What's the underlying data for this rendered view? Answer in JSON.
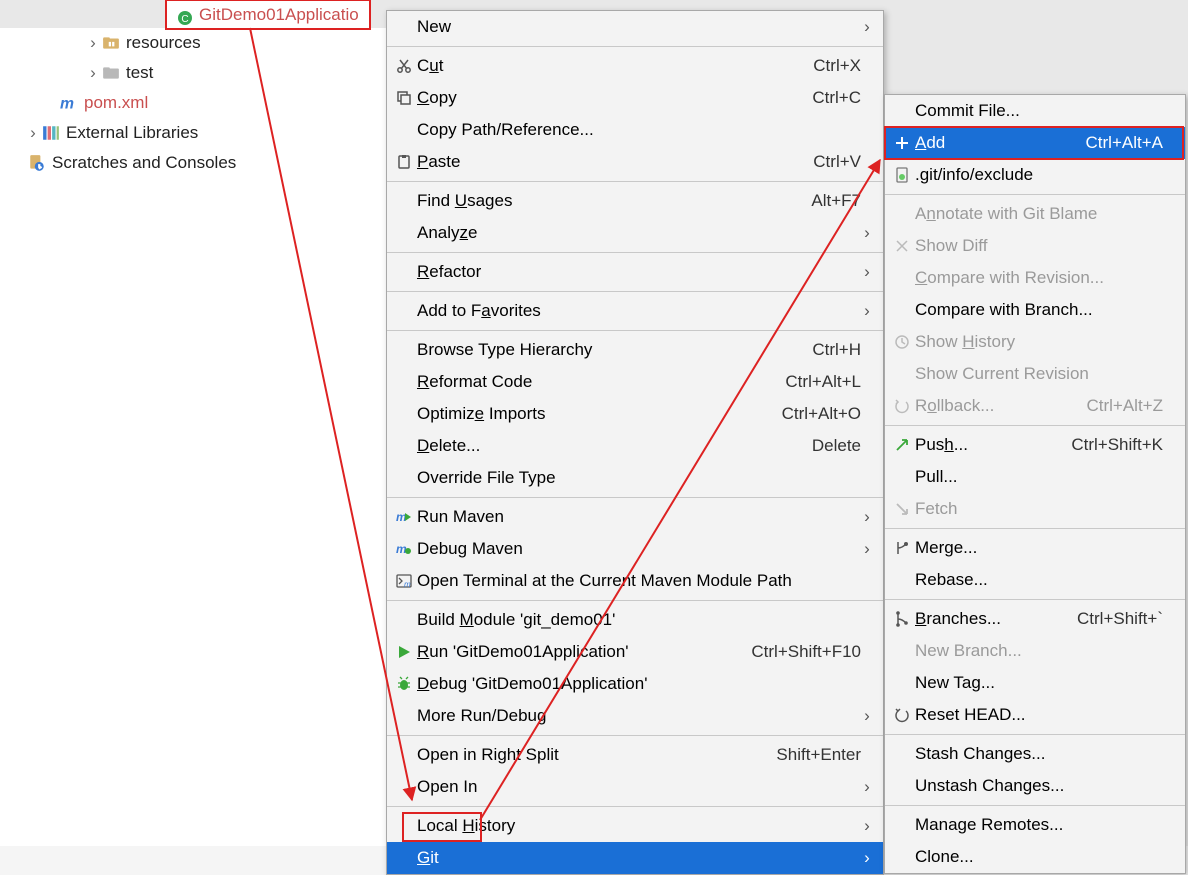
{
  "tabs": {
    "active": "GitDemo01Applicatio"
  },
  "tree": {
    "resources": "resources",
    "test": "test",
    "pom": "pom.xml",
    "ext_lib": "External Libraries",
    "scratches": "Scratches and Consoles"
  },
  "menu1": {
    "new": "New",
    "cut": "Cut",
    "cut_sc": "Ctrl+X",
    "copy": "Copy",
    "copy_sc": "Ctrl+C",
    "copy_path": "Copy Path/Reference...",
    "paste": "Paste",
    "paste_sc": "Ctrl+V",
    "find_usages": "Find Usages",
    "find_usages_sc": "Alt+F7",
    "analyze": "Analyze",
    "refactor": "Refactor",
    "favorites": "Add to Favorites",
    "type_hier": "Browse Type Hierarchy",
    "type_hier_sc": "Ctrl+H",
    "reformat": "Reformat Code",
    "reformat_sc": "Ctrl+Alt+L",
    "optimize": "Optimize Imports",
    "optimize_sc": "Ctrl+Alt+O",
    "delete": "Delete...",
    "delete_sc": "Delete",
    "override_ft": "Override File Type",
    "run_maven": "Run Maven",
    "debug_maven": "Debug Maven",
    "open_term_maven": "Open Terminal at the Current Maven Module Path",
    "build_module": "Build Module 'git_demo01'",
    "run_app": "Run 'GitDemo01Application'",
    "run_app_sc": "Ctrl+Shift+F10",
    "debug_app": "Debug 'GitDemo01Application'",
    "more_run": "More Run/Debug",
    "open_split": "Open in Right Split",
    "open_split_sc": "Shift+Enter",
    "open_in": "Open In",
    "local_history": "Local History",
    "git": "Git"
  },
  "menu2": {
    "commit": "Commit File...",
    "add": "Add",
    "add_sc": "Ctrl+Alt+A",
    "exclude": ".git/info/exclude",
    "annotate": "Annotate with Git Blame",
    "show_diff": "Show Diff",
    "compare_rev": "Compare with Revision...",
    "compare_branch": "Compare with Branch...",
    "show_history": "Show History",
    "show_cur_rev": "Show Current Revision",
    "rollback": "Rollback...",
    "rollback_sc": "Ctrl+Alt+Z",
    "push": "Push...",
    "push_sc": "Ctrl+Shift+K",
    "pull": "Pull...",
    "fetch": "Fetch",
    "merge": "Merge...",
    "rebase": "Rebase...",
    "branches": "Branches...",
    "branches_sc": "Ctrl+Shift+`",
    "new_branch": "New Branch...",
    "new_tag": "New Tag...",
    "reset_head": "Reset HEAD...",
    "stash": "Stash Changes...",
    "unstash": "Unstash Changes...",
    "manage_remotes": "Manage Remotes...",
    "clone": "Clone..."
  }
}
